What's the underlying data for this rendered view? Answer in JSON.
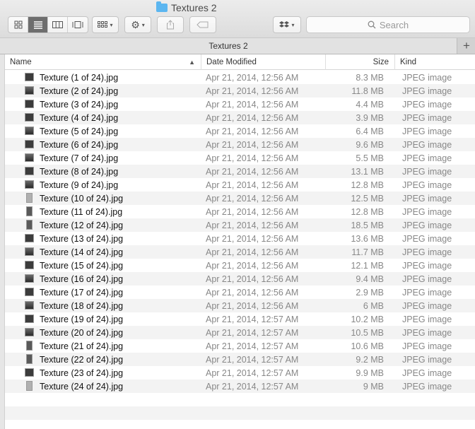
{
  "window": {
    "title": "Textures 2"
  },
  "toolbar": {
    "view_modes": [
      "icon",
      "list",
      "column",
      "cover-flow"
    ],
    "active_view": "list",
    "search_placeholder": "Search"
  },
  "tabs": [
    {
      "label": "Textures 2"
    }
  ],
  "columns": {
    "name": "Name",
    "date": "Date Modified",
    "size": "Size",
    "kind": "Kind"
  },
  "files": [
    {
      "name": "Texture (1 of 24).jpg",
      "date": "Apr 21, 2014, 12:56 AM",
      "size": "8.3 MB",
      "kind": "JPEG image"
    },
    {
      "name": "Texture (2 of 24).jpg",
      "date": "Apr 21, 2014, 12:56 AM",
      "size": "11.8 MB",
      "kind": "JPEG image"
    },
    {
      "name": "Texture (3 of 24).jpg",
      "date": "Apr 21, 2014, 12:56 AM",
      "size": "4.4 MB",
      "kind": "JPEG image"
    },
    {
      "name": "Texture (4 of 24).jpg",
      "date": "Apr 21, 2014, 12:56 AM",
      "size": "3.9 MB",
      "kind": "JPEG image"
    },
    {
      "name": "Texture (5 of 24).jpg",
      "date": "Apr 21, 2014, 12:56 AM",
      "size": "6.4 MB",
      "kind": "JPEG image"
    },
    {
      "name": "Texture (6 of 24).jpg",
      "date": "Apr 21, 2014, 12:56 AM",
      "size": "9.6 MB",
      "kind": "JPEG image"
    },
    {
      "name": "Texture (7 of 24).jpg",
      "date": "Apr 21, 2014, 12:56 AM",
      "size": "5.5 MB",
      "kind": "JPEG image"
    },
    {
      "name": "Texture (8 of 24).jpg",
      "date": "Apr 21, 2014, 12:56 AM",
      "size": "13.1 MB",
      "kind": "JPEG image"
    },
    {
      "name": "Texture (9 of 24).jpg",
      "date": "Apr 21, 2014, 12:56 AM",
      "size": "12.8 MB",
      "kind": "JPEG image"
    },
    {
      "name": "Texture (10 of 24).jpg",
      "date": "Apr 21, 2014, 12:56 AM",
      "size": "12.5 MB",
      "kind": "JPEG image"
    },
    {
      "name": "Texture (11 of 24).jpg",
      "date": "Apr 21, 2014, 12:56 AM",
      "size": "12.8 MB",
      "kind": "JPEG image"
    },
    {
      "name": "Texture (12 of 24).jpg",
      "date": "Apr 21, 2014, 12:56 AM",
      "size": "18.5 MB",
      "kind": "JPEG image"
    },
    {
      "name": "Texture (13 of 24).jpg",
      "date": "Apr 21, 2014, 12:56 AM",
      "size": "13.6 MB",
      "kind": "JPEG image"
    },
    {
      "name": "Texture (14 of 24).jpg",
      "date": "Apr 21, 2014, 12:56 AM",
      "size": "11.7 MB",
      "kind": "JPEG image"
    },
    {
      "name": "Texture (15 of 24).jpg",
      "date": "Apr 21, 2014, 12:56 AM",
      "size": "12.1 MB",
      "kind": "JPEG image"
    },
    {
      "name": "Texture (16 of 24).jpg",
      "date": "Apr 21, 2014, 12:56 AM",
      "size": "9.4 MB",
      "kind": "JPEG image"
    },
    {
      "name": "Texture (17 of 24).jpg",
      "date": "Apr 21, 2014, 12:56 AM",
      "size": "2.9 MB",
      "kind": "JPEG image"
    },
    {
      "name": "Texture (18 of 24).jpg",
      "date": "Apr 21, 2014, 12:56 AM",
      "size": "6 MB",
      "kind": "JPEG image"
    },
    {
      "name": "Texture (19 of 24).jpg",
      "date": "Apr 21, 2014, 12:57 AM",
      "size": "10.2 MB",
      "kind": "JPEG image"
    },
    {
      "name": "Texture (20 of 24).jpg",
      "date": "Apr 21, 2014, 12:57 AM",
      "size": "10.5 MB",
      "kind": "JPEG image"
    },
    {
      "name": "Texture (21 of 24).jpg",
      "date": "Apr 21, 2014, 12:57 AM",
      "size": "10.6 MB",
      "kind": "JPEG image"
    },
    {
      "name": "Texture (22 of 24).jpg",
      "date": "Apr 21, 2014, 12:57 AM",
      "size": "9.2 MB",
      "kind": "JPEG image"
    },
    {
      "name": "Texture (23 of 24).jpg",
      "date": "Apr 21, 2014, 12:57 AM",
      "size": "9.9 MB",
      "kind": "JPEG image"
    },
    {
      "name": "Texture (24 of 24).jpg",
      "date": "Apr 21, 2014, 12:57 AM",
      "size": "9 MB",
      "kind": "JPEG image"
    }
  ]
}
